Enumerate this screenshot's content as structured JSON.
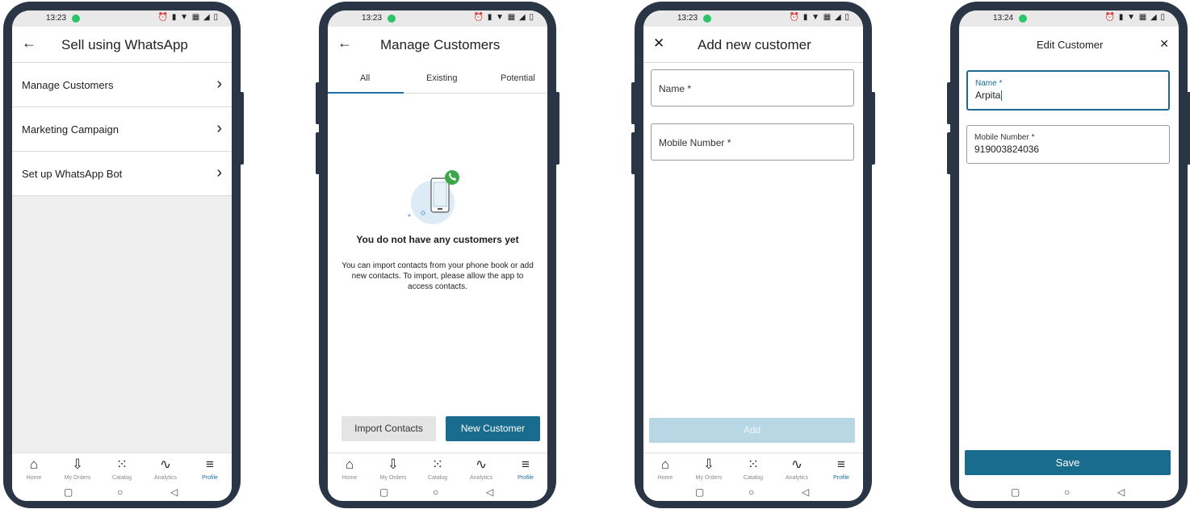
{
  "status": {
    "time1": "13:23",
    "time2": "13:23",
    "time3": "13:23",
    "time4": "13:24",
    "icons": "⏰ ▮ ▼ ▦ ◢ ▯"
  },
  "screen1": {
    "title": "Sell using WhatsApp",
    "items": [
      {
        "label": "Manage Customers"
      },
      {
        "label": "Marketing Campaign"
      },
      {
        "label": "Set up WhatsApp Bot"
      }
    ]
  },
  "screen2": {
    "title": "Manage Customers",
    "tabs": [
      "All",
      "Existing",
      "Potential"
    ],
    "empty_title": "You do not have any customers yet",
    "empty_text": "You can import contacts from your phone book or add new contacts. To import, please allow the app to access contacts.",
    "import_label": "Import Contacts",
    "new_label": "New Customer"
  },
  "screen3": {
    "title": "Add new customer",
    "name_placeholder": "Name *",
    "mobile_placeholder": "Mobile Number *",
    "add_label": "Add"
  },
  "screen4": {
    "title": "Edit Customer",
    "name_label": "Name *",
    "name_value": "Arpita",
    "mobile_label": "Mobile Number *",
    "mobile_value": "919003824036",
    "save_label": "Save"
  },
  "nav": {
    "home": "Home",
    "orders": "My Orders",
    "catalog": "Catalog",
    "analytics": "Analytics",
    "profile": "Profile"
  },
  "icons": {
    "back": "←",
    "close": "✕",
    "chevron": "›",
    "home": "⌂",
    "orders": "⇩",
    "catalog": "⁙",
    "analytics": "∿",
    "profile": "≡",
    "square": "▢",
    "circle": "○",
    "triangle": "◁"
  },
  "colors": {
    "accent": "#1a6c8f",
    "accent_light": "#b7d7e4",
    "whatsapp": "#2cc36b"
  }
}
